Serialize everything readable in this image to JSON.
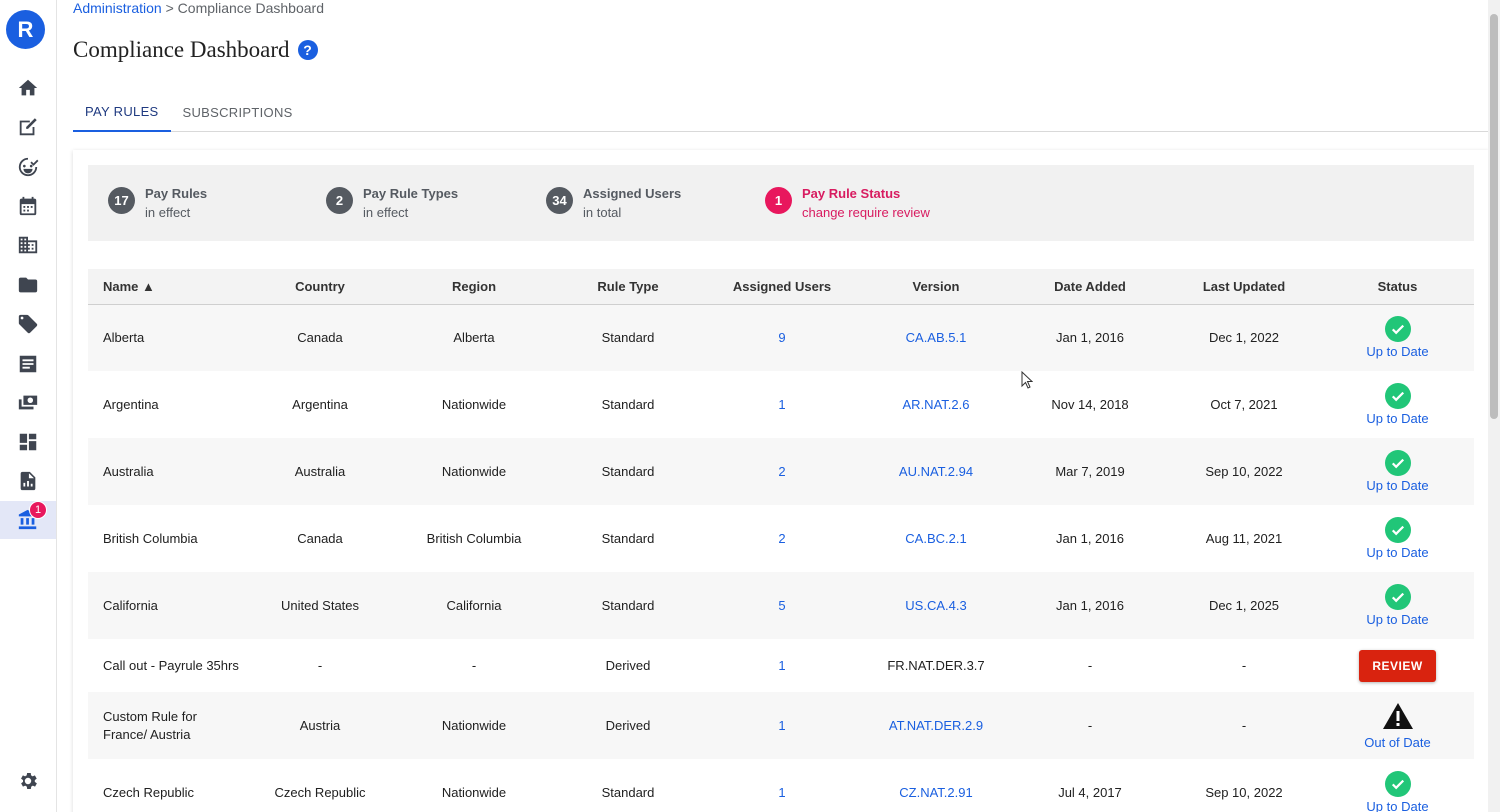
{
  "app": {
    "logo_letter": "R",
    "nav_badge_count": "1"
  },
  "breadcrumb": {
    "parent": "Administration",
    "separator": " > ",
    "current": "Compliance Dashboard"
  },
  "page": {
    "title": "Compliance Dashboard",
    "help_glyph": "?"
  },
  "tabs": [
    {
      "label": "PAY RULES"
    },
    {
      "label": "SUBSCRIPTIONS"
    }
  ],
  "stats": [
    {
      "count": "17",
      "title": "Pay Rules",
      "sub": "in effect"
    },
    {
      "count": "2",
      "title": "Pay Rule Types",
      "sub": "in effect"
    },
    {
      "count": "34",
      "title": "Assigned Users",
      "sub": "in total"
    },
    {
      "count": "1",
      "title": "Pay Rule Status",
      "sub": "change require review"
    }
  ],
  "table": {
    "headers": [
      "Name ▲",
      "Country",
      "Region",
      "Rule Type",
      "Assigned Users",
      "Version",
      "Date Added",
      "Last Updated",
      "Status"
    ],
    "rows": [
      {
        "name": "Alberta",
        "country": "Canada",
        "region": "Alberta",
        "rule_type": "Standard",
        "users": "9",
        "version": "CA.AB.5.1",
        "date_added": "Jan 1, 2016",
        "last_updated": "Dec 1, 2022",
        "status": "Up to Date"
      },
      {
        "name": "Argentina",
        "country": "Argentina",
        "region": "Nationwide",
        "rule_type": "Standard",
        "users": "1",
        "version": "AR.NAT.2.6",
        "date_added": "Nov 14, 2018",
        "last_updated": "Oct 7, 2021",
        "status": "Up to Date"
      },
      {
        "name": "Australia",
        "country": "Australia",
        "region": "Nationwide",
        "rule_type": "Standard",
        "users": "2",
        "version": "AU.NAT.2.94",
        "date_added": "Mar 7, 2019",
        "last_updated": "Sep 10, 2022",
        "status": "Up to Date"
      },
      {
        "name": "British Columbia",
        "country": "Canada",
        "region": "British Columbia",
        "rule_type": "Standard",
        "users": "2",
        "version": "CA.BC.2.1",
        "date_added": "Jan 1, 2016",
        "last_updated": "Aug 11, 2021",
        "status": "Up to Date"
      },
      {
        "name": "California",
        "country": "United States",
        "region": "California",
        "rule_type": "Standard",
        "users": "5",
        "version": "US.CA.4.3",
        "date_added": "Jan 1, 2016",
        "last_updated": "Dec 1, 2025",
        "status": "Up to Date"
      },
      {
        "name": "Call out - Payrule 35hrs",
        "country": "-",
        "region": "-",
        "rule_type": "Derived",
        "users": "1",
        "version": "FR.NAT.DER.3.7",
        "date_added": "-",
        "last_updated": "-",
        "status": "REVIEW"
      },
      {
        "name": "Custom Rule for France/ Austria",
        "country": "Austria",
        "region": "Nationwide",
        "rule_type": "Derived",
        "users": "1",
        "version": "AT.NAT.DER.2.9",
        "date_added": "-",
        "last_updated": "-",
        "status": "Out of Date"
      },
      {
        "name": "Czech Republic",
        "country": "Czech Republic",
        "region": "Nationwide",
        "rule_type": "Standard",
        "users": "1",
        "version": "CZ.NAT.2.91",
        "date_added": "Jul 4, 2017",
        "last_updated": "Sep 10, 2022",
        "status": "Up to Date"
      }
    ]
  },
  "colors": {
    "accent": "#1a5fe0",
    "alert": "#e8175d",
    "success": "#21c678",
    "danger": "#d9230f"
  }
}
